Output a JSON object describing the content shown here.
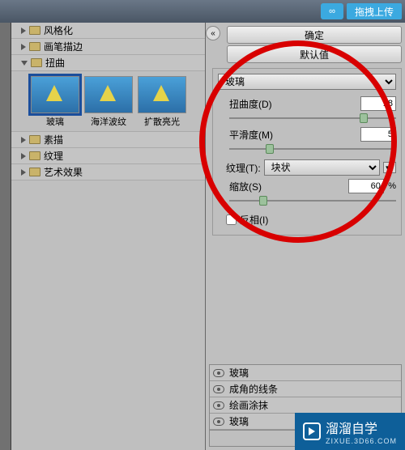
{
  "topbar": {
    "upload_label": "拖拽上传"
  },
  "buttons": {
    "ok": "确定",
    "defaults": "默认值"
  },
  "tree": {
    "items": [
      {
        "label": "风格化"
      },
      {
        "label": "画笔描边"
      },
      {
        "label": "扭曲"
      },
      {
        "label": "素描"
      },
      {
        "label": "纹理"
      },
      {
        "label": "艺术效果"
      }
    ]
  },
  "thumbs": {
    "t0": "玻璃",
    "t1": "海洋波纹",
    "t2": "扩散亮光"
  },
  "filter": {
    "select_value": "玻璃",
    "distortion_label": "扭曲度(D)",
    "distortion_value": "18",
    "smoothness_label": "平滑度(M)",
    "smoothness_value": "5",
    "texture_label": "纹理(T):",
    "texture_value": "块状",
    "scale_label": "缩放(S)",
    "scale_value": "60",
    "scale_unit": "%",
    "invert_label": "反相(I)"
  },
  "layers": {
    "r0": "玻璃",
    "r1": "成角的线条",
    "r2": "绘画涂抹",
    "r3": "玻璃"
  },
  "watermark": {
    "brand": "溜溜自学",
    "sub": "ZIXUE.3D66.COM"
  }
}
